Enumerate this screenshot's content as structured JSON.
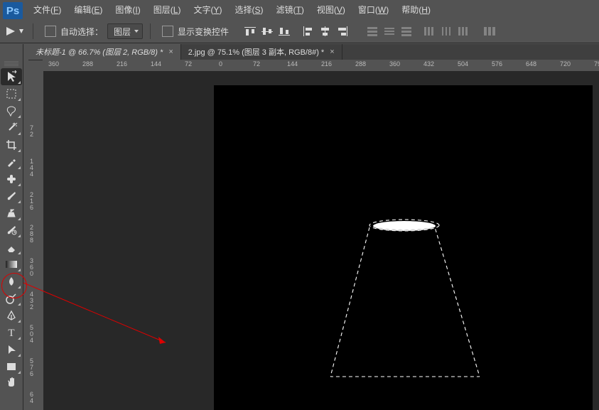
{
  "app": {
    "logo": "Ps"
  },
  "menu": {
    "file": {
      "label": "文件",
      "key": "F"
    },
    "edit": {
      "label": "编辑",
      "key": "E"
    },
    "image": {
      "label": "图像",
      "key": "I"
    },
    "layer": {
      "label": "图层",
      "key": "L"
    },
    "type": {
      "label": "文字",
      "key": "Y"
    },
    "select": {
      "label": "选择",
      "key": "S"
    },
    "filter": {
      "label": "滤镜",
      "key": "T"
    },
    "view": {
      "label": "视图",
      "key": "V"
    },
    "window": {
      "label": "窗口",
      "key": "W"
    },
    "help": {
      "label": "帮助",
      "key": "H"
    }
  },
  "options": {
    "auto_select_label": "自动选择：",
    "auto_select_target": "图层",
    "show_transform_label": "显示变换控件"
  },
  "tabs": {
    "a": {
      "title": "未标题-1 @ 66.7% (图层 2, RGB/8) *"
    },
    "b": {
      "title": "2.jpg @ 75.1% (图层 3 副本, RGB/8#) *"
    }
  },
  "ruler_h": [
    "360",
    "288",
    "216",
    "144",
    "72",
    "0",
    "72",
    "144",
    "216",
    "288",
    "360",
    "432",
    "504",
    "576",
    "648",
    "720",
    "79"
  ],
  "ruler_v": [
    {
      "v": "7",
      "p": 76
    },
    {
      "v": "2",
      "p": 85
    },
    {
      "v": "1",
      "p": 123
    },
    {
      "v": "4",
      "p": 132
    },
    {
      "v": "4",
      "p": 141
    },
    {
      "v": "2",
      "p": 170
    },
    {
      "v": "1",
      "p": 179
    },
    {
      "v": "6",
      "p": 188
    },
    {
      "v": "2",
      "p": 216
    },
    {
      "v": "8",
      "p": 225
    },
    {
      "v": "8",
      "p": 234
    },
    {
      "v": "3",
      "p": 263
    },
    {
      "v": "6",
      "p": 272
    },
    {
      "v": "0",
      "p": 281
    },
    {
      "v": "4",
      "p": 310
    },
    {
      "v": "3",
      "p": 319
    },
    {
      "v": "2",
      "p": 328
    },
    {
      "v": "5",
      "p": 357
    },
    {
      "v": "0",
      "p": 366
    },
    {
      "v": "4",
      "p": 375
    },
    {
      "v": "5",
      "p": 404
    },
    {
      "v": "7",
      "p": 413
    },
    {
      "v": "6",
      "p": 422
    },
    {
      "v": "6",
      "p": 451
    },
    {
      "v": "4",
      "p": 460
    }
  ]
}
